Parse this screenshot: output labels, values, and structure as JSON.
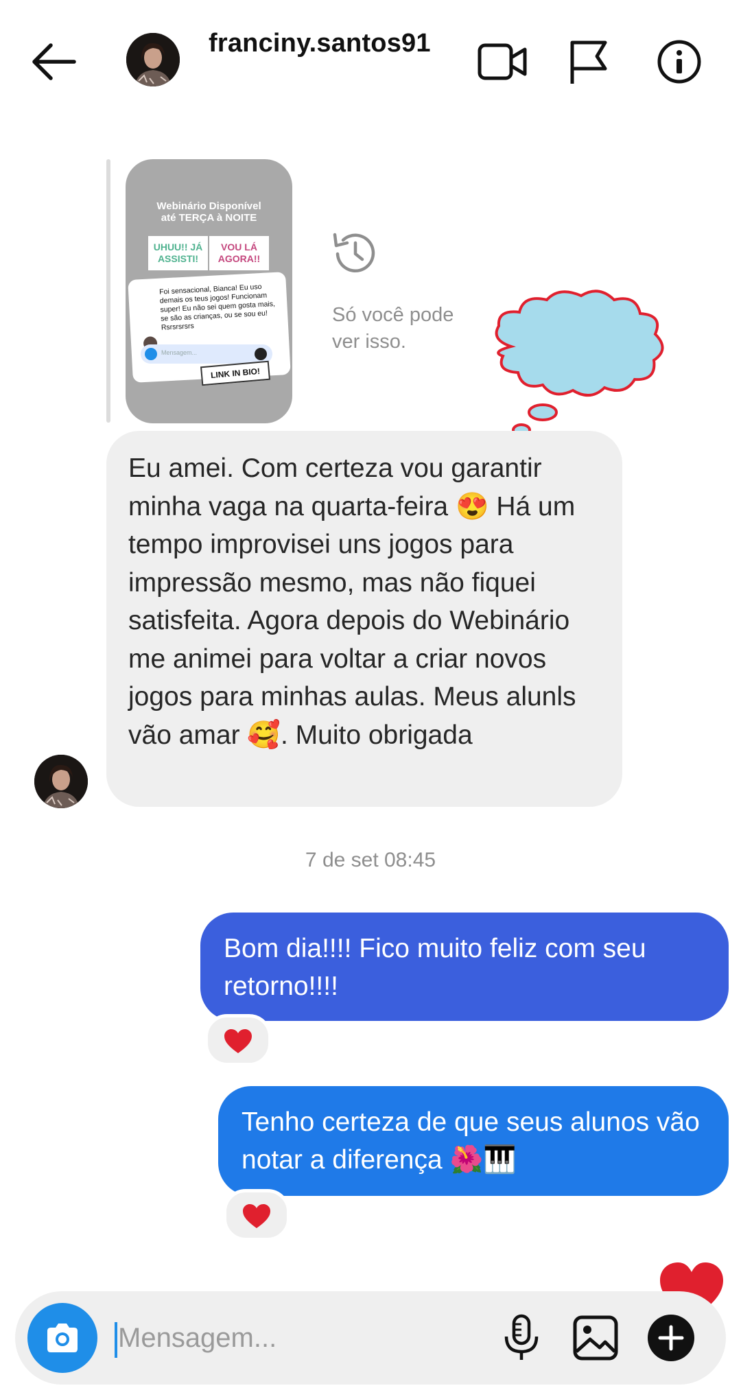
{
  "header": {
    "username": "franciny.santos91",
    "icons": [
      "back-arrow-icon",
      "video-call-icon",
      "flag-icon",
      "info-icon"
    ]
  },
  "story_reply": {
    "story_title_line1": "Webinário Disponível",
    "story_title_line2": "até TERÇA à NOITE",
    "option1": "UHUU!! JÁ ASSISTI!",
    "option2": "VOU LÁ AGORA!!",
    "card_text": "Foi sensacional, Bianca! Eu uso demais os teus jogos! Funcionam super! Eu não sei quem gosta mais, se são as crianças, ou se sou eu! Rsrsrsrsrs",
    "card_input_placeholder": "Mensagem...",
    "banner": "LINK IN BIO!",
    "visibility_note": "Só você pode\nver isso."
  },
  "messages": {
    "received_text": "Eu amei. Com certeza vou garantir minha vaga na quarta-feira 😍 Há um tempo improvisei uns jogos para impressão mesmo, mas não fiquei satisfeita. Agora depois do Webinário me animei para voltar a criar novos jogos para minhas aulas. Meus alunls vão amar 🥰. Muito obrigada",
    "timestamp": "7 de set 08:45",
    "sent1_text": "Bom dia!!!! Fico muito feliz com seu retorno!!!!",
    "sent2_text": "Tenho certeza de que seus alunos vão notar a diferença 🌺🎹",
    "reaction": "heart"
  },
  "composer": {
    "placeholder": "Mensagem...",
    "icons": [
      "camera-icon",
      "microphone-icon",
      "gallery-icon",
      "plus-icon"
    ]
  },
  "colors": {
    "sent1_bubble": "#3b5fdd",
    "sent2_bubble": "#1f7ae8",
    "received_bubble": "#efefef",
    "camera_button": "#1f8ee8",
    "heart": "#e0202e"
  }
}
